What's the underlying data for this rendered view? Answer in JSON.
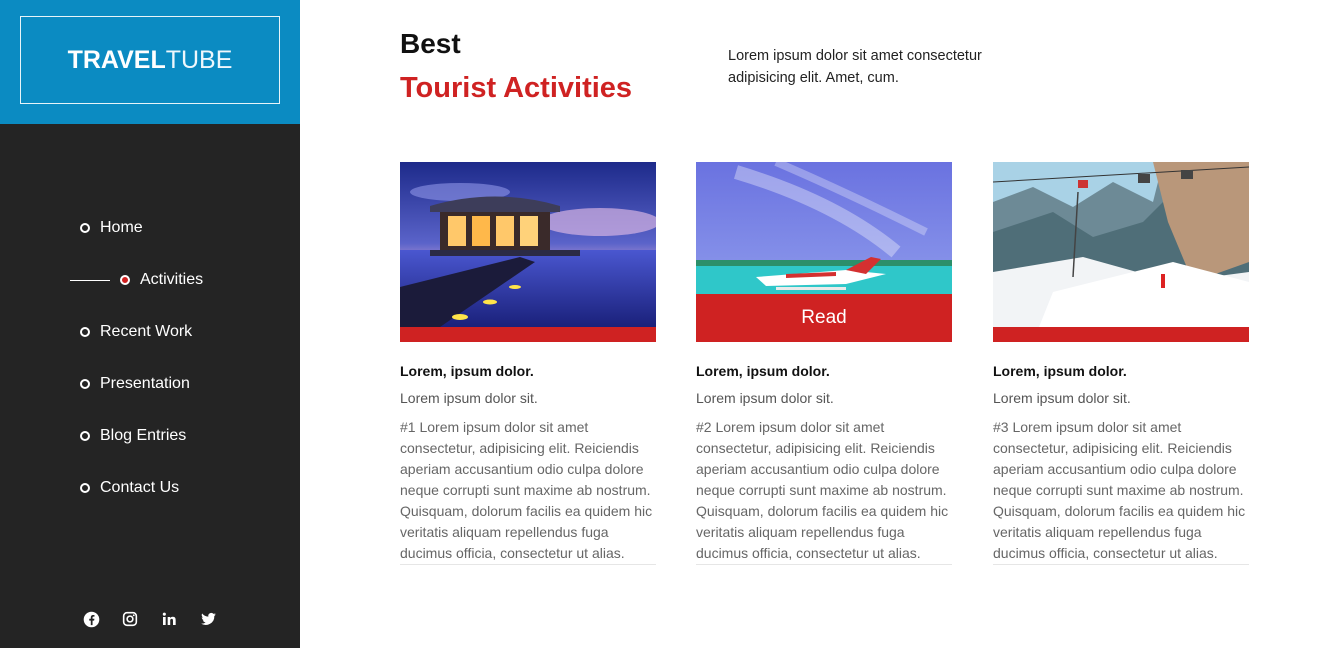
{
  "logo": {
    "bold": "TRAVEL",
    "light": "TUBE"
  },
  "nav": [
    {
      "label": "Home",
      "active": false
    },
    {
      "label": "Activities",
      "active": true
    },
    {
      "label": "Recent Work",
      "active": false
    },
    {
      "label": "Presentation",
      "active": false
    },
    {
      "label": "Blog Entries",
      "active": false
    },
    {
      "label": "Contact Us",
      "active": false
    }
  ],
  "social": [
    "facebook-icon",
    "instagram-icon",
    "linkedin-icon",
    "twitter-icon"
  ],
  "header": {
    "best": "Best",
    "title": "Tourist Activities",
    "intro": "Lorem ipsum dolor sit amet consectetur adipisicing elit. Amet, cum."
  },
  "cards": [
    {
      "title": "Lorem, ipsum dolor.",
      "subtitle": "Lorem ipsum dolor sit.",
      "body": "#1 Lorem ipsum dolor sit amet consectetur, adipisicing elit. Reiciendis aperiam accusantium odio culpa dolore neque corrupti sunt maxime ab nostrum. Quisquam, dolorum facilis ea quidem hic veritatis aliquam repellendus fuga ducimus officia, consectetur ut alias."
    },
    {
      "title": "Lorem, ipsum dolor.",
      "subtitle": "Lorem ipsum dolor sit.",
      "read_label": "Read",
      "body": "#2 Lorem ipsum dolor sit amet consectetur, adipisicing elit. Reiciendis aperiam accusantium odio culpa dolore neque corrupti sunt maxime ab nostrum. Quisquam, dolorum facilis ea quidem hic veritatis aliquam repellendus fuga ducimus officia, consectetur ut alias."
    },
    {
      "title": "Lorem, ipsum dolor.",
      "subtitle": "Lorem ipsum dolor sit.",
      "body": "#3 Lorem ipsum dolor sit amet consectetur, adipisicing elit. Reiciendis aperiam accusantium odio culpa dolore neque corrupti sunt maxime ab nostrum. Quisquam, dolorum facilis ea quidem hic veritatis aliquam repellendus fuga ducimus officia, consectetur ut alias."
    }
  ],
  "colors": {
    "brand_blue": "#0b8bc2",
    "accent_red": "#cf2222",
    "sidebar_bg": "#242424"
  }
}
